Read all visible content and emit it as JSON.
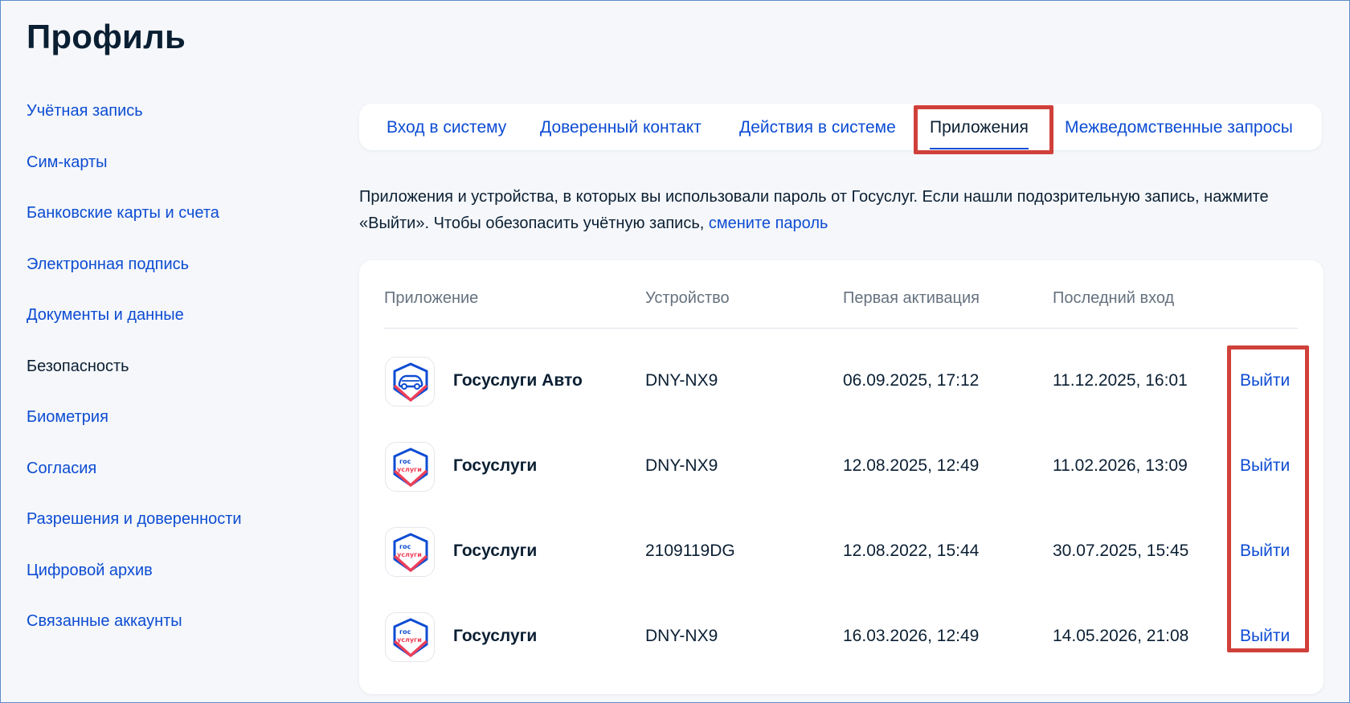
{
  "page": {
    "title": "Профиль"
  },
  "sidebar": {
    "items": [
      {
        "label": "Учётная запись",
        "active": false
      },
      {
        "label": "Сим-карты",
        "active": false
      },
      {
        "label": "Банковские карты и счета",
        "active": false
      },
      {
        "label": "Электронная подпись",
        "active": false
      },
      {
        "label": "Документы и данные",
        "active": false
      },
      {
        "label": "Безопасность",
        "active": true
      },
      {
        "label": "Биометрия",
        "active": false
      },
      {
        "label": "Согласия",
        "active": false
      },
      {
        "label": "Разрешения и доверенности",
        "active": false
      },
      {
        "label": "Цифровой архив",
        "active": false
      },
      {
        "label": "Связанные аккаунты",
        "active": false
      }
    ]
  },
  "tabs": {
    "items": [
      {
        "label": "Вход в систему",
        "active": false
      },
      {
        "label": "Доверенный контакт",
        "active": false
      },
      {
        "label": "Действия в системе",
        "active": false
      },
      {
        "label": "Приложения",
        "active": true
      },
      {
        "label": "Межведомственные запросы",
        "active": false
      }
    ]
  },
  "description": {
    "text": "Приложения и устройства, в которых вы использовали пароль от Госуслуг. Если нашли подозрительную запись, нажмите «Выйти». Чтобы обезопасить учётную запись, ",
    "link": "смените пароль"
  },
  "table": {
    "headers": {
      "app": "Приложение",
      "device": "Устройство",
      "first_activation": "Первая активация",
      "last_login": "Последний вход"
    },
    "rows": [
      {
        "icon": "gosuslugi-auto-icon",
        "app": "Госуслуги Авто",
        "device": "DNY-NX9",
        "first_activation": "06.09.2025, 17:12",
        "last_login": "11.12.2025, 16:01",
        "action": "Выйти"
      },
      {
        "icon": "gosuslugi-icon",
        "app": "Госуслуги",
        "device": "DNY-NX9",
        "first_activation": "12.08.2025, 12:49",
        "last_login": "11.02.2026, 13:09",
        "action": "Выйти"
      },
      {
        "icon": "gosuslugi-icon",
        "app": "Госуслуги",
        "device": "2109119DG",
        "first_activation": "12.08.2022, 15:44",
        "last_login": "30.07.2025, 15:45",
        "action": "Выйти"
      },
      {
        "icon": "gosuslugi-icon",
        "app": "Госуслуги",
        "device": "DNY-NX9",
        "first_activation": "16.03.2026, 12:49",
        "last_login": "14.05.2026, 21:08",
        "action": "Выйти"
      }
    ],
    "gos_icon_text": {
      "line1": "гос",
      "line2": "услуги"
    }
  },
  "colors": {
    "accent": "#0d4cd3",
    "text": "#0b1f33",
    "muted": "#66727f",
    "highlight": "#d0403a",
    "brand_blue": "#0d4cd3",
    "brand_red": "#ee3f58"
  }
}
